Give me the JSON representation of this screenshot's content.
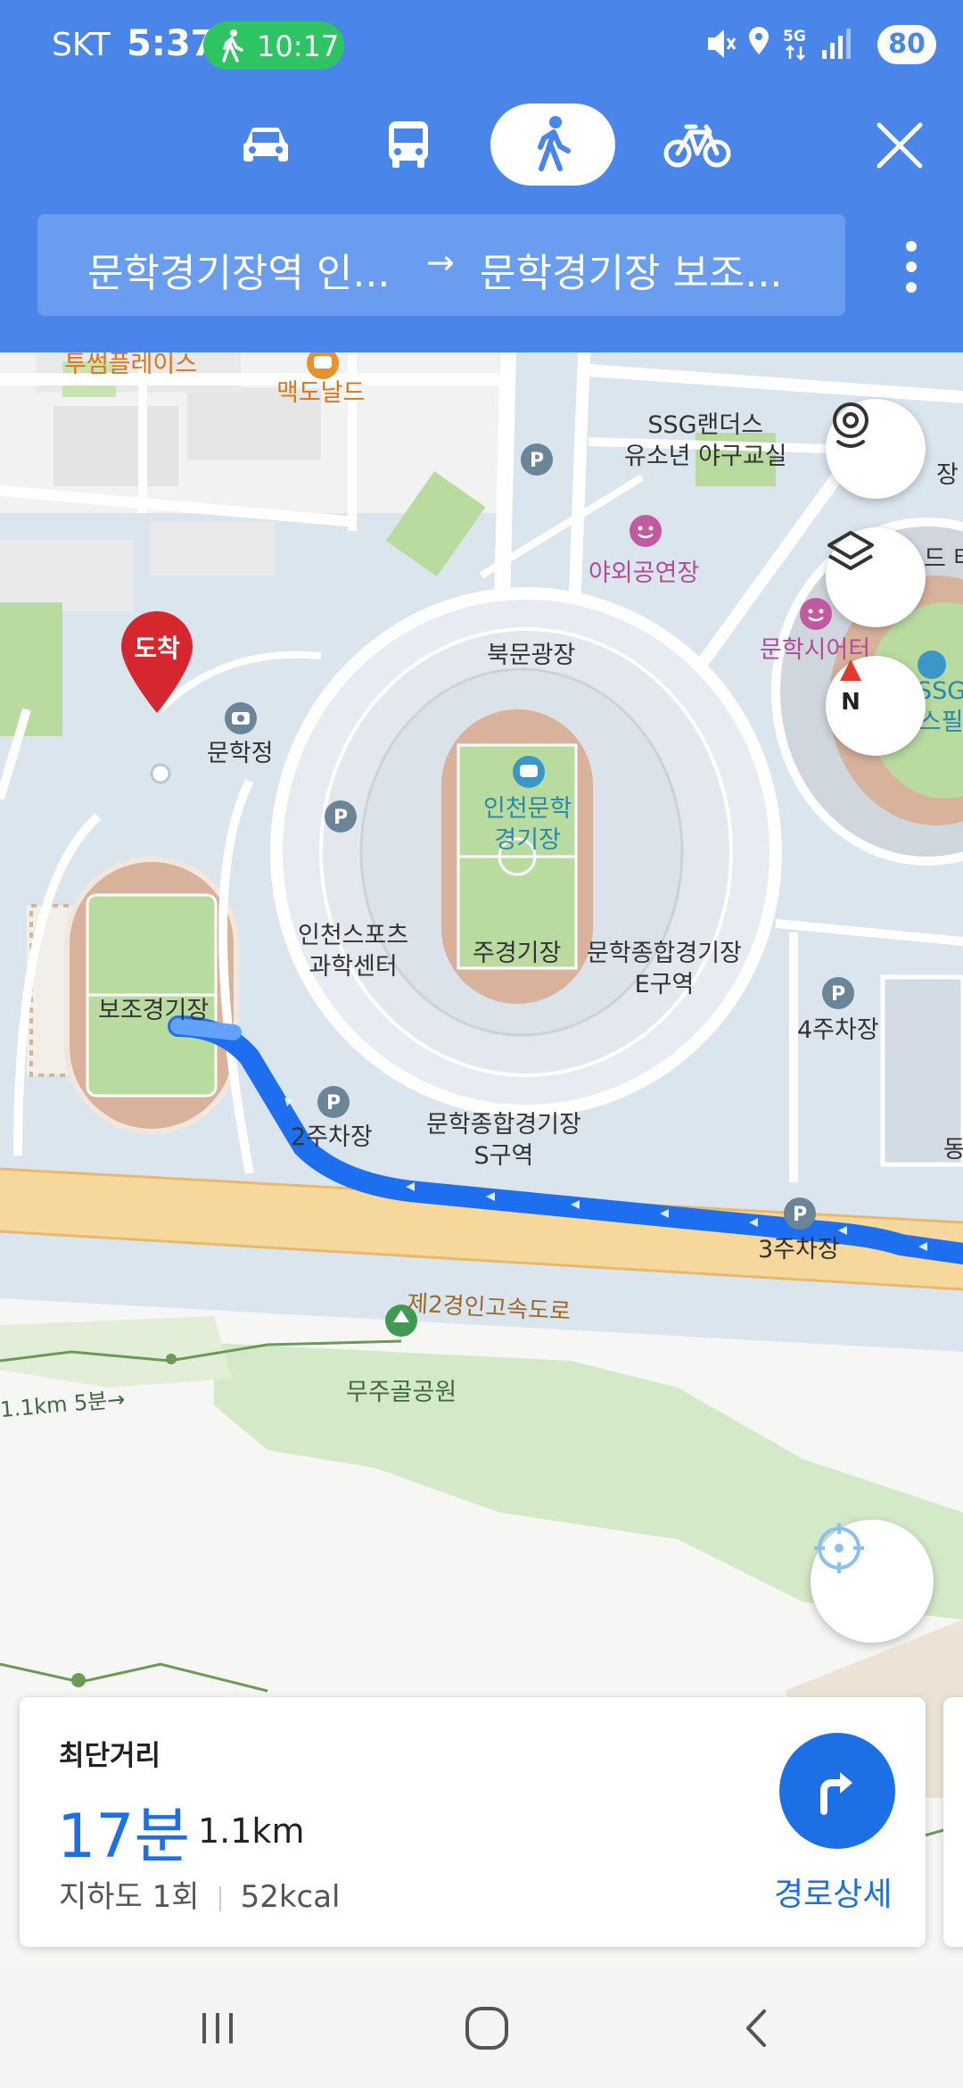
{
  "status_bar": {
    "carrier": "SKT",
    "time": "5:37",
    "walk_timer": "10:17",
    "battery": "80",
    "icons": [
      "mute-icon",
      "location-icon",
      "5g-icon",
      "signal-icon",
      "battery-icon"
    ]
  },
  "modes": [
    {
      "name": "car",
      "icon": "car-icon",
      "active": false
    },
    {
      "name": "bus",
      "icon": "bus-icon",
      "active": false
    },
    {
      "name": "walk",
      "icon": "walk-icon",
      "active": true
    },
    {
      "name": "bike",
      "icon": "bike-icon",
      "active": false
    }
  ],
  "route": {
    "from": "문학경기장역 인...",
    "arrow": "→",
    "to": "문학경기장 보조..."
  },
  "map": {
    "labels": {
      "tusseom": "투썸플레이스",
      "mcdonalds": "맥도날드",
      "ssg": "SSG랜더스\n유소년 야구교실",
      "outdoor_stage": "야외공연장",
      "theater": "문학시어터",
      "north_plaza": "북문광장",
      "munhakjeong": "문학정",
      "stadium": "인천문학\n경기장",
      "sports_center": "인천스포츠\n과학센터",
      "main_stadium": "주경기장",
      "e_zone": "문학종합경기장\nE구역",
      "s_zone": "문학종합경기장\nS구역",
      "parking2": "2주차장",
      "parking3": "3주차장",
      "parking4": "4주차장",
      "sub_stadium": "보조경기장",
      "arrival": "도착",
      "highway": "제2경인고속도로",
      "park": "무주골공원",
      "trail": "1.1km 5분→",
      "edge_jang": "장",
      "edge_dong": "동",
      "edge_te": "드 테",
      "edge_ssg": "SSG\n스필"
    },
    "colors": {
      "route": "#1e6ff0",
      "marker": "#d6262e",
      "header": "#4a86ea"
    }
  },
  "summary": {
    "title": "최단거리",
    "time": "17분",
    "distance": "1.1km",
    "underpass": "지하도 1회",
    "calories": "52kcal",
    "detail_label": "경로상세"
  },
  "navbar": [
    "recent-apps-icon",
    "home-icon",
    "back-icon"
  ]
}
